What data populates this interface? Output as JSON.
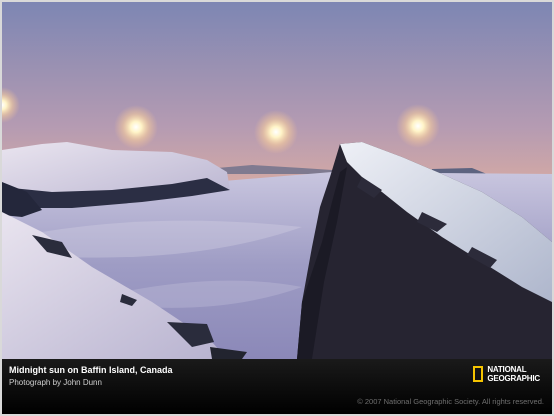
{
  "caption": {
    "title": "Midnight sun on Baffin Island, Canada",
    "credit": "Photograph by John Dunn",
    "copyright": "© 2007 National Geographic Society. All rights reserved."
  },
  "brand": {
    "logo_line1": "NATIONAL",
    "logo_line2": "GEOGRAPHIC",
    "accent_color": "#f5c400"
  }
}
